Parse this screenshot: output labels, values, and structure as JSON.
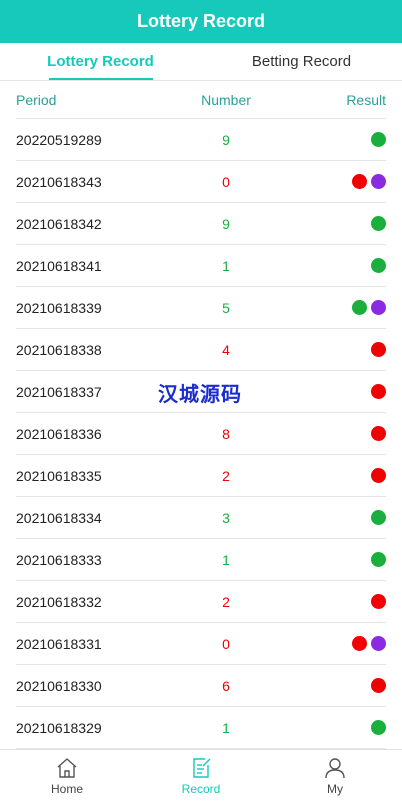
{
  "header": {
    "title": "Lottery Record"
  },
  "tabs": [
    {
      "label": "Lottery Record",
      "active": true
    },
    {
      "label": "Betting Record",
      "active": false
    }
  ],
  "columns": {
    "period": "Period",
    "number": "Number",
    "result": "Result"
  },
  "colors": {
    "accent": "#17c9bb",
    "green": "#1aaf3c",
    "red": "#f00000",
    "violet": "#8a2be2"
  },
  "rows": [
    {
      "period": "20220519289",
      "number": "9",
      "number_color": "green",
      "result": [
        "green"
      ]
    },
    {
      "period": "20210618343",
      "number": "0",
      "number_color": "red",
      "result": [
        "red",
        "violet"
      ]
    },
    {
      "period": "20210618342",
      "number": "9",
      "number_color": "green",
      "result": [
        "green"
      ]
    },
    {
      "period": "20210618341",
      "number": "1",
      "number_color": "green",
      "result": [
        "green"
      ]
    },
    {
      "period": "20210618339",
      "number": "5",
      "number_color": "green",
      "result": [
        "green",
        "violet"
      ]
    },
    {
      "period": "20210618338",
      "number": "4",
      "number_color": "red",
      "result": [
        "red"
      ]
    },
    {
      "period": "20210618337",
      "number": "",
      "number_color": "red",
      "result": [
        "red"
      ]
    },
    {
      "period": "20210618336",
      "number": "8",
      "number_color": "red",
      "result": [
        "red"
      ]
    },
    {
      "period": "20210618335",
      "number": "2",
      "number_color": "red",
      "result": [
        "red"
      ]
    },
    {
      "period": "20210618334",
      "number": "3",
      "number_color": "green",
      "result": [
        "green"
      ]
    },
    {
      "period": "20210618333",
      "number": "1",
      "number_color": "green",
      "result": [
        "green"
      ]
    },
    {
      "period": "20210618332",
      "number": "2",
      "number_color": "red",
      "result": [
        "red"
      ]
    },
    {
      "period": "20210618331",
      "number": "0",
      "number_color": "red",
      "result": [
        "red",
        "violet"
      ]
    },
    {
      "period": "20210618330",
      "number": "6",
      "number_color": "red",
      "result": [
        "red"
      ]
    },
    {
      "period": "20210618329",
      "number": "1",
      "number_color": "green",
      "result": [
        "green"
      ]
    }
  ],
  "watermark": "汉城源码",
  "tabbar": [
    {
      "label": "Home",
      "icon": "home-icon",
      "active": false
    },
    {
      "label": "Record",
      "icon": "record-icon",
      "active": true
    },
    {
      "label": "My",
      "icon": "user-icon",
      "active": false
    }
  ]
}
